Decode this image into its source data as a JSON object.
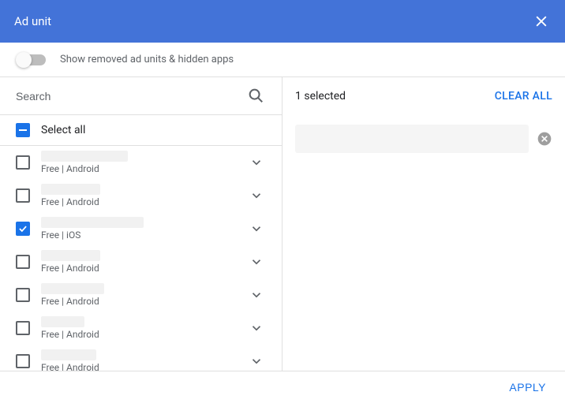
{
  "header": {
    "title": "Ad unit"
  },
  "toggle": {
    "label": "Show removed ad units & hidden apps",
    "checked": false
  },
  "search": {
    "placeholder": "Search"
  },
  "selectAll": {
    "label": "Select all"
  },
  "items": [
    {
      "nameWidth": 110,
      "sub": "Free | Android",
      "checked": false
    },
    {
      "nameWidth": 75,
      "sub": "Free | Android",
      "checked": false
    },
    {
      "nameWidth": 130,
      "sub": "Free | iOS",
      "checked": true
    },
    {
      "nameWidth": 75,
      "sub": "Free | Android",
      "checked": false
    },
    {
      "nameWidth": 80,
      "sub": "Free | Android",
      "checked": false
    },
    {
      "nameWidth": 55,
      "sub": "Free | Android",
      "checked": false
    },
    {
      "nameWidth": 70,
      "sub": "Free | Android",
      "checked": false
    }
  ],
  "rightPanel": {
    "selectedCount": "1 selected",
    "clearAll": "CLEAR ALL"
  },
  "footer": {
    "apply": "APPLY"
  }
}
